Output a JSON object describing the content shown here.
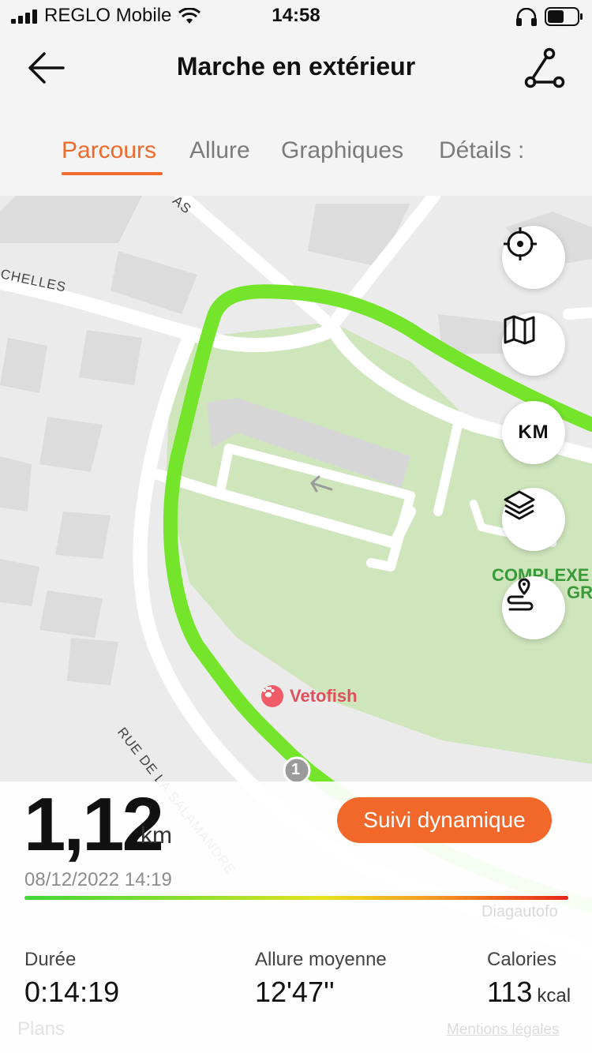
{
  "status_bar": {
    "carrier": "REGLO Mobile",
    "time": "14:58"
  },
  "nav": {
    "title": "Marche en extérieur"
  },
  "tabs": [
    {
      "label": "Parcours",
      "active": true
    },
    {
      "label": "Allure",
      "active": false
    },
    {
      "label": "Graphiques",
      "active": false
    },
    {
      "label": "Détails :",
      "active": false
    }
  ],
  "map": {
    "street_labels": [
      "AS",
      "CHELLES",
      "RUE DE LA SALAMANDRE"
    ],
    "poi_complexe": "COMPLEXE",
    "poi_complexe_2": "GR",
    "poi_vetofish": "Vetofish",
    "km_marker": "1",
    "buttons": [
      "locate-icon",
      "map-icon",
      "km-toggle",
      "layers-icon",
      "route-pin-icon"
    ],
    "km_label": "KM",
    "route_color": "#74e52a",
    "park_color": "#cfe6bd"
  },
  "summary": {
    "distance": "1,12",
    "distance_unit": "km",
    "datetime": "08/12/2022 14:19",
    "follow_button": "Suivi dynamique",
    "watermark": "Diagautofo",
    "stats": [
      {
        "label": "Durée",
        "value": "0:14:19",
        "unit": ""
      },
      {
        "label": "Allure moyenne",
        "value": "12'47''",
        "unit": ""
      },
      {
        "label": "Calories",
        "value": "113",
        "unit": "kcal"
      }
    ],
    "attribution": "Plans",
    "legal": "Mentions légales"
  },
  "colors": {
    "accent": "#f06a2c",
    "button": "#f2672a"
  }
}
